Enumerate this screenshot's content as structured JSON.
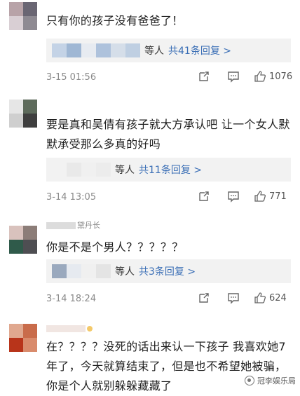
{
  "comments": [
    {
      "text": "只有你的孩子没有爸爸了！",
      "others_label": "等人",
      "reply_link": "共41条回复 >",
      "time": "3-15 01:56",
      "likes": "1076",
      "avatar_colors": [
        "#b8a3a8",
        "#6a6673",
        "#d9cfd4",
        "#8e8a92"
      ],
      "pixel_colors": [
        "#c4d3e6",
        "#9fb7d4",
        "#e7ebf1",
        "#aec2dc",
        "#d5dee9",
        "#bfcfe2"
      ]
    },
    {
      "text": "要是真和吴倩有孩子就大方承认吧 让一个女人默默承受那么多真的好吗",
      "others_label": "等人",
      "reply_link": "共11条回复 >",
      "time": "3-14 13:05",
      "likes": "771",
      "avatar_colors": [
        "#e6e6e6",
        "#5e6b5c",
        "#cfcfcf",
        "#3f3f3f"
      ],
      "pixel_colors": [
        "#f2f2f2",
        "#e9e9e9",
        "#f0f0f0",
        "#ececec",
        "#f4f4f4",
        "#eeeeee"
      ]
    },
    {
      "text": "你是不是个男人？？？？？",
      "others_label": "等人",
      "reply_link": "共3条回复 >",
      "time": "3-14 18:24",
      "likes": "624",
      "username_partial": "黛丹长",
      "avatar_colors": [
        "#d9c2bd",
        "#8c7d78",
        "#2f5a4a",
        "#4e4e52"
      ],
      "pixel_colors": [
        "#9aa9be",
        "#e6eaf0",
        "#f0f0f0",
        "#e4e4e4",
        "#eaeaea",
        "#f2f2f2"
      ]
    },
    {
      "text": "在？？？？没死的话出来认一下孩子 我喜欢她7年了，今天就算结束了，但是也不希望她被骗，你是个人就别躲躲藏藏了",
      "avatar_colors": [
        "#e0a88f",
        "#c96c4b",
        "#b8341a",
        "#d98b6c"
      ]
    }
  ],
  "watermark": "冠李娱乐局"
}
